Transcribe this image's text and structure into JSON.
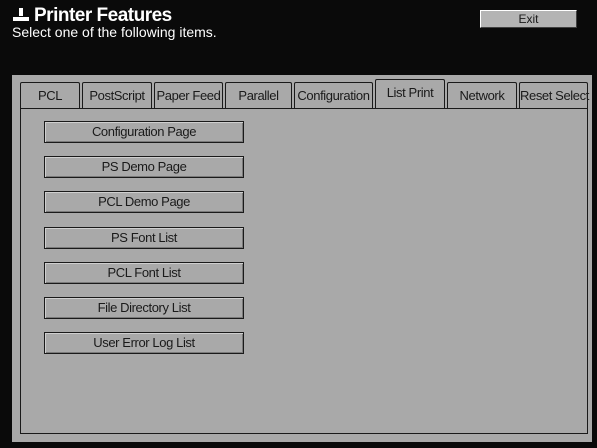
{
  "window": {
    "title": "Printer Features",
    "title_icon": "printer-icon",
    "exit_label": "Exit"
  },
  "prompt": "Select one of the following items.",
  "tabs": [
    {
      "label": "PCL",
      "active": false
    },
    {
      "label": "PostScript",
      "active": false
    },
    {
      "label": "Paper Feed",
      "active": false
    },
    {
      "label": "Parallel",
      "active": false
    },
    {
      "label": "Configuration",
      "active": false
    },
    {
      "label": "List Print",
      "active": true
    },
    {
      "label": "Network",
      "active": false
    },
    {
      "label": "Reset Select",
      "active": false
    }
  ],
  "items": [
    {
      "label": "Configuration Page"
    },
    {
      "label": "PS Demo Page"
    },
    {
      "label": "PCL Demo Page"
    },
    {
      "label": "PS Font List"
    },
    {
      "label": "PCL Font List"
    },
    {
      "label": "File Directory List"
    },
    {
      "label": "User Error Log List"
    }
  ],
  "colors": {
    "background": "#0a0a0a",
    "panel": "#a9a9a9",
    "text_light": "#ffffff",
    "text_dark": "#1a1a1a"
  }
}
